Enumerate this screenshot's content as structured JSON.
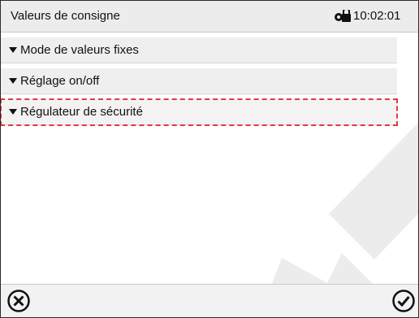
{
  "header": {
    "title": "Valeurs de consigne",
    "lock_icon": "lock-icon",
    "time": "10:02:01"
  },
  "menu": {
    "items": [
      {
        "label": "Mode de valeurs fixes",
        "icon": "triangle-down-icon",
        "selected": false
      },
      {
        "label": "Réglage on/off",
        "icon": "triangle-down-icon",
        "selected": false
      },
      {
        "label": "Régulateur de sécurité",
        "icon": "triangle-down-icon",
        "selected": true
      }
    ]
  },
  "footer": {
    "cancel_icon": "cancel-icon",
    "confirm_icon": "confirm-icon"
  },
  "colors": {
    "header_bg": "#ececec",
    "selection_outline": "#e03a3a",
    "watermark": "#ececec"
  }
}
